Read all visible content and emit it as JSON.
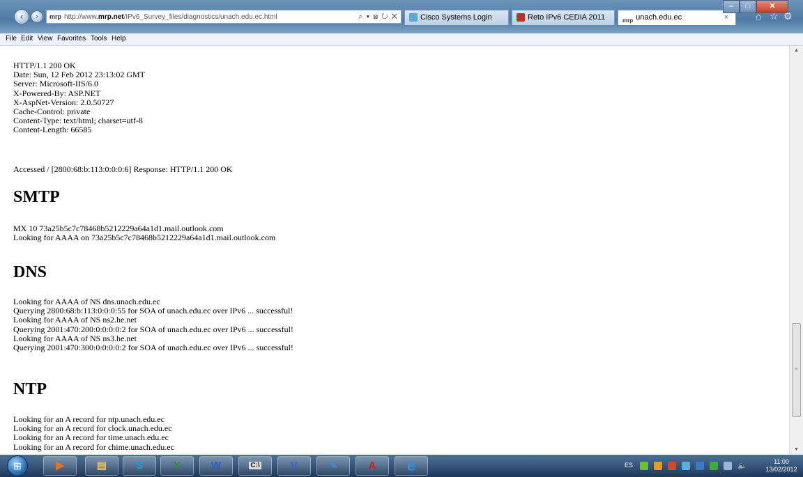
{
  "browser": {
    "address_prefix": "http://www.",
    "address_domain": "mrp.net",
    "address_path": "/IPv6_Survey_files/diagnostics/unach.edu.ec.html",
    "address_tools": "⌕ ▾ ⊠ ↻ ✕",
    "favicon_text": "mrp",
    "tabs": [
      {
        "label": "Cisco Systems Login",
        "icon": "cisco-icon",
        "color": "#5aa9d6"
      },
      {
        "label": "Reto IPv6 CEDIA 2011",
        "icon": "cedia-icon",
        "color": "#b7332b"
      },
      {
        "label": "unach.edu.ec",
        "icon": "mrp-icon",
        "color": "#333333",
        "close": "×"
      }
    ],
    "window_controls": {
      "minimize": "–",
      "maximize": "□",
      "close": "✕"
    },
    "right_icons": [
      "home-icon",
      "favorites-star-icon",
      "tools-gear-icon"
    ]
  },
  "menu": [
    "File",
    "Edit",
    "View",
    "Favorites",
    "Tools",
    "Help"
  ],
  "page": {
    "headers": [
      "HTTP/1.1 200 OK",
      "Date: Sun, 12 Feb 2012 23:13:02 GMT",
      "Server: Microsoft-IIS/6.0",
      "X-Powered-By: ASP.NET",
      "X-AspNet-Version: 2.0.50727",
      "Cache-Control: private",
      "Content-Type: text/html; charset=utf-8",
      "Content-Length: 66585"
    ],
    "accessed": "Accessed / [2800:68:b:113:0:0:0:6] Response: HTTP/1.1 200 OK",
    "smtp": {
      "heading": "SMTP",
      "lines": [
        "MX 10 73a25b5c7c78468b5212229a64a1d1.mail.outlook.com",
        "Looking for AAAA on 73a25b5c7c78468b5212229a64a1d1.mail.outlook.com"
      ]
    },
    "dns": {
      "heading": "DNS",
      "lines": [
        "Looking for AAAA of NS dns.unach.edu.ec",
        "Querying 2800:68:b:113:0:0:0:55 for SOA of unach.edu.ec over IPv6 ... successful!",
        "Looking for AAAA of NS ns2.he.net",
        "Querying 2001:470:200:0:0:0:0:2 for SOA of unach.edu.ec over IPv6 ... successful!",
        "Looking for AAAA of NS ns3.he.net",
        "Querying 2001:470:300:0:0:0:0:2 for SOA of unach.edu.ec over IPv6 ... successful!"
      ]
    },
    "ntp": {
      "heading": "NTP",
      "lines": [
        "Looking for an A record for ntp.unach.edu.ec",
        "Looking for an A record for clock.unach.edu.ec",
        "Looking for an A record for time.unach.edu.ec",
        "Looking for an A record for chime.unach.edu.ec"
      ]
    }
  },
  "taskbar": {
    "buttons": [
      {
        "name": "media-player-button",
        "glyph": "▶",
        "color": "#e8731f"
      },
      {
        "name": "explorer-folder-button",
        "glyph": "▤",
        "color": "#e9c25a"
      },
      {
        "name": "skype-button",
        "glyph": "S",
        "color": "#1ea1de"
      },
      {
        "name": "excel-button",
        "glyph": "X",
        "color": "#2f8a3c"
      },
      {
        "name": "word-button",
        "glyph": "W",
        "color": "#2e5fb8"
      },
      {
        "name": "command-prompt-button",
        "glyph": "C:\\",
        "color": "#222222"
      },
      {
        "name": "visio-button",
        "glyph": "V",
        "color": "#3b64c7"
      },
      {
        "name": "paint-button",
        "glyph": "✎",
        "color": "#4a87cf"
      },
      {
        "name": "acrobat-button",
        "glyph": "A",
        "color": "#c8231c"
      },
      {
        "name": "internet-explorer-button",
        "glyph": "e",
        "color": "#2f8ee0"
      }
    ],
    "language": "ES",
    "time": "11:00",
    "date": "13/02/2012"
  }
}
